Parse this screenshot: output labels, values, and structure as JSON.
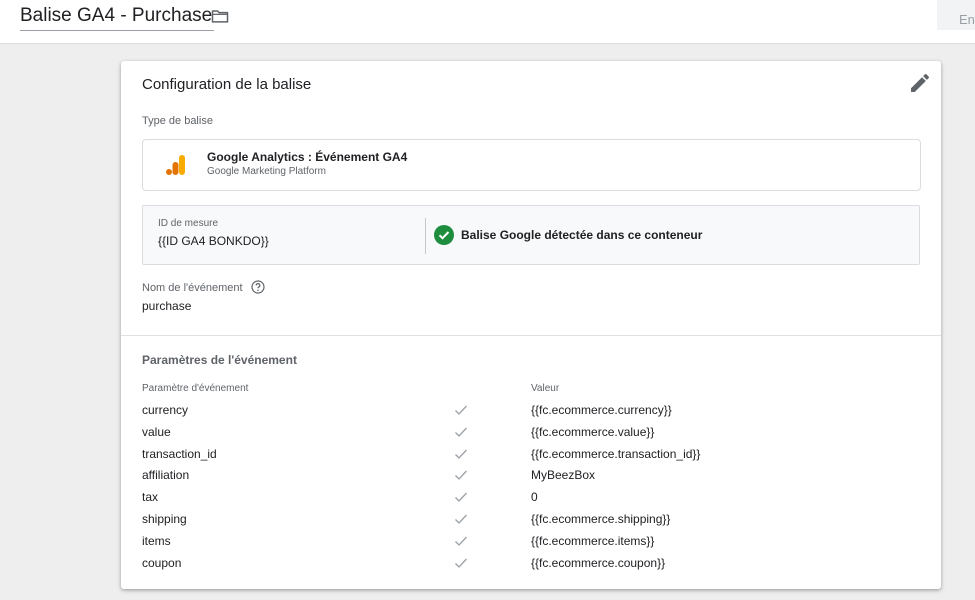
{
  "header": {
    "tag_name": "Balise GA4 - Purchase",
    "save_label": "En"
  },
  "card": {
    "title": "Configuration de la balise",
    "tag_type_label": "Type de balise",
    "tag_type": {
      "name": "Google Analytics : Événement GA4",
      "subtitle": "Google Marketing Platform"
    },
    "measurement": {
      "label": "ID de mesure",
      "value": "{{ID GA4 BONKDO}}",
      "status": "Balise Google détectée dans ce conteneur",
      "status_color": "#1e8e3e"
    },
    "event_name": {
      "label": "Nom de l'événement",
      "value": "purchase"
    },
    "params": {
      "title": "Paramètres de l'événement",
      "col_param": "Paramètre d'événement",
      "col_value": "Valeur",
      "rows": [
        {
          "name": "currency",
          "value": "{{fc.ecommerce.currency}}"
        },
        {
          "name": "value",
          "value": "{{fc.ecommerce.value}}"
        },
        {
          "name": "transaction_id",
          "value": "{{fc.ecommerce.transaction_id}}"
        },
        {
          "name": "affiliation",
          "value": "MyBeezBox"
        },
        {
          "name": "tax",
          "value": "0"
        },
        {
          "name": "shipping",
          "value": "{{fc.ecommerce.shipping}}"
        },
        {
          "name": "items",
          "value": "{{fc.ecommerce.items}}"
        },
        {
          "name": "coupon",
          "value": "{{fc.ecommerce.coupon}}"
        }
      ]
    }
  },
  "icons": {
    "folder": "folder-icon",
    "edit": "pencil-icon",
    "logo": "google-analytics-logo",
    "detected": "check-circle-icon",
    "help": "help-icon",
    "row_check": "check-icon"
  },
  "colors": {
    "ga_orange": "#f9ab00",
    "ga_dark_orange": "#e37400",
    "check_green": "#1e8e3e"
  }
}
